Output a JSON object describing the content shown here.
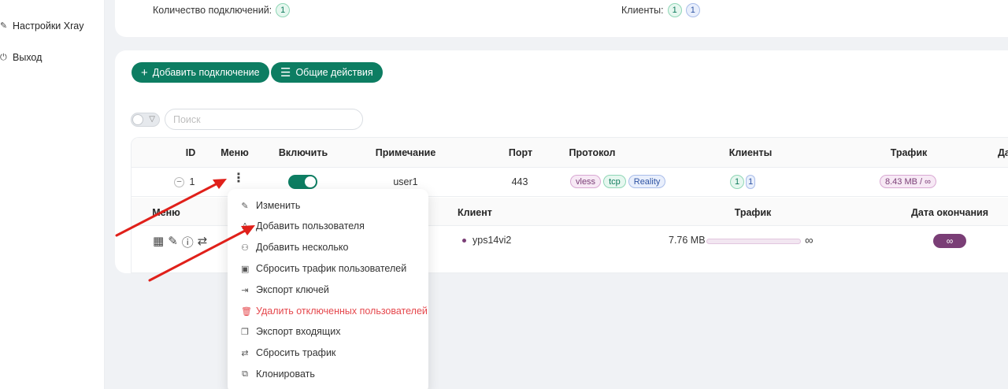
{
  "sidebar": {
    "items": [
      {
        "label": "Настройки Xray",
        "icon": "wrench-icon"
      },
      {
        "label": "Выход",
        "icon": "logout-icon"
      }
    ]
  },
  "stats": {
    "connections_label": "Количество подключений:",
    "connections_value": "1",
    "clients_label": "Клиенты:",
    "clients_green": "1",
    "clients_blue": "1"
  },
  "toolbar": {
    "add_connection": "Добавить подключение",
    "general_actions": "Общие действия"
  },
  "search": {
    "placeholder": "Поиск"
  },
  "table": {
    "headers": {
      "id": "ID",
      "menu": "Меню",
      "enable": "Включить",
      "note": "Примечание",
      "port": "Порт",
      "protocol": "Протокол",
      "clients": "Клиенты",
      "traffic": "Трафик",
      "date": "Дата"
    },
    "row": {
      "expand": "–",
      "id": "1",
      "menu_dots": "⋮",
      "note": "user1",
      "port": "443",
      "protocol_tags": [
        "vless",
        "tcp",
        "Reality"
      ],
      "clients_green": "1",
      "clients_blue": "1",
      "traffic": "8.43 MB / ∞"
    }
  },
  "subtable": {
    "headers": {
      "menu": "Меню",
      "client": "Клиент",
      "traffic": "Трафик",
      "expiry": "Дата окончания"
    },
    "row": {
      "client": "yps14vi2",
      "traffic": "7.76 MB",
      "traffic_limit": "∞",
      "expiry": "∞"
    }
  },
  "dropdown": {
    "items": [
      {
        "label": "Изменить",
        "icon": "pencil-icon"
      },
      {
        "label": "Добавить пользователя",
        "icon": "user-icon"
      },
      {
        "label": "Добавить несколько",
        "icon": "users-icon"
      },
      {
        "label": "Сбросить трафик пользователей",
        "icon": "reset-doc-icon"
      },
      {
        "label": "Экспорт ключей",
        "icon": "export-icon"
      },
      {
        "label": "Удалить отключенных пользователей",
        "icon": "trash-icon"
      },
      {
        "label": "Экспорт входящих",
        "icon": "copy-icon"
      },
      {
        "label": "Сбросить трафик",
        "icon": "retweet-icon"
      },
      {
        "label": "Клонировать",
        "icon": "clone-icon"
      }
    ]
  },
  "colors": {
    "accent": "#0d7d62",
    "danger": "#e5484d",
    "purple": "#7a3e76",
    "arrow": "#e0201a"
  }
}
